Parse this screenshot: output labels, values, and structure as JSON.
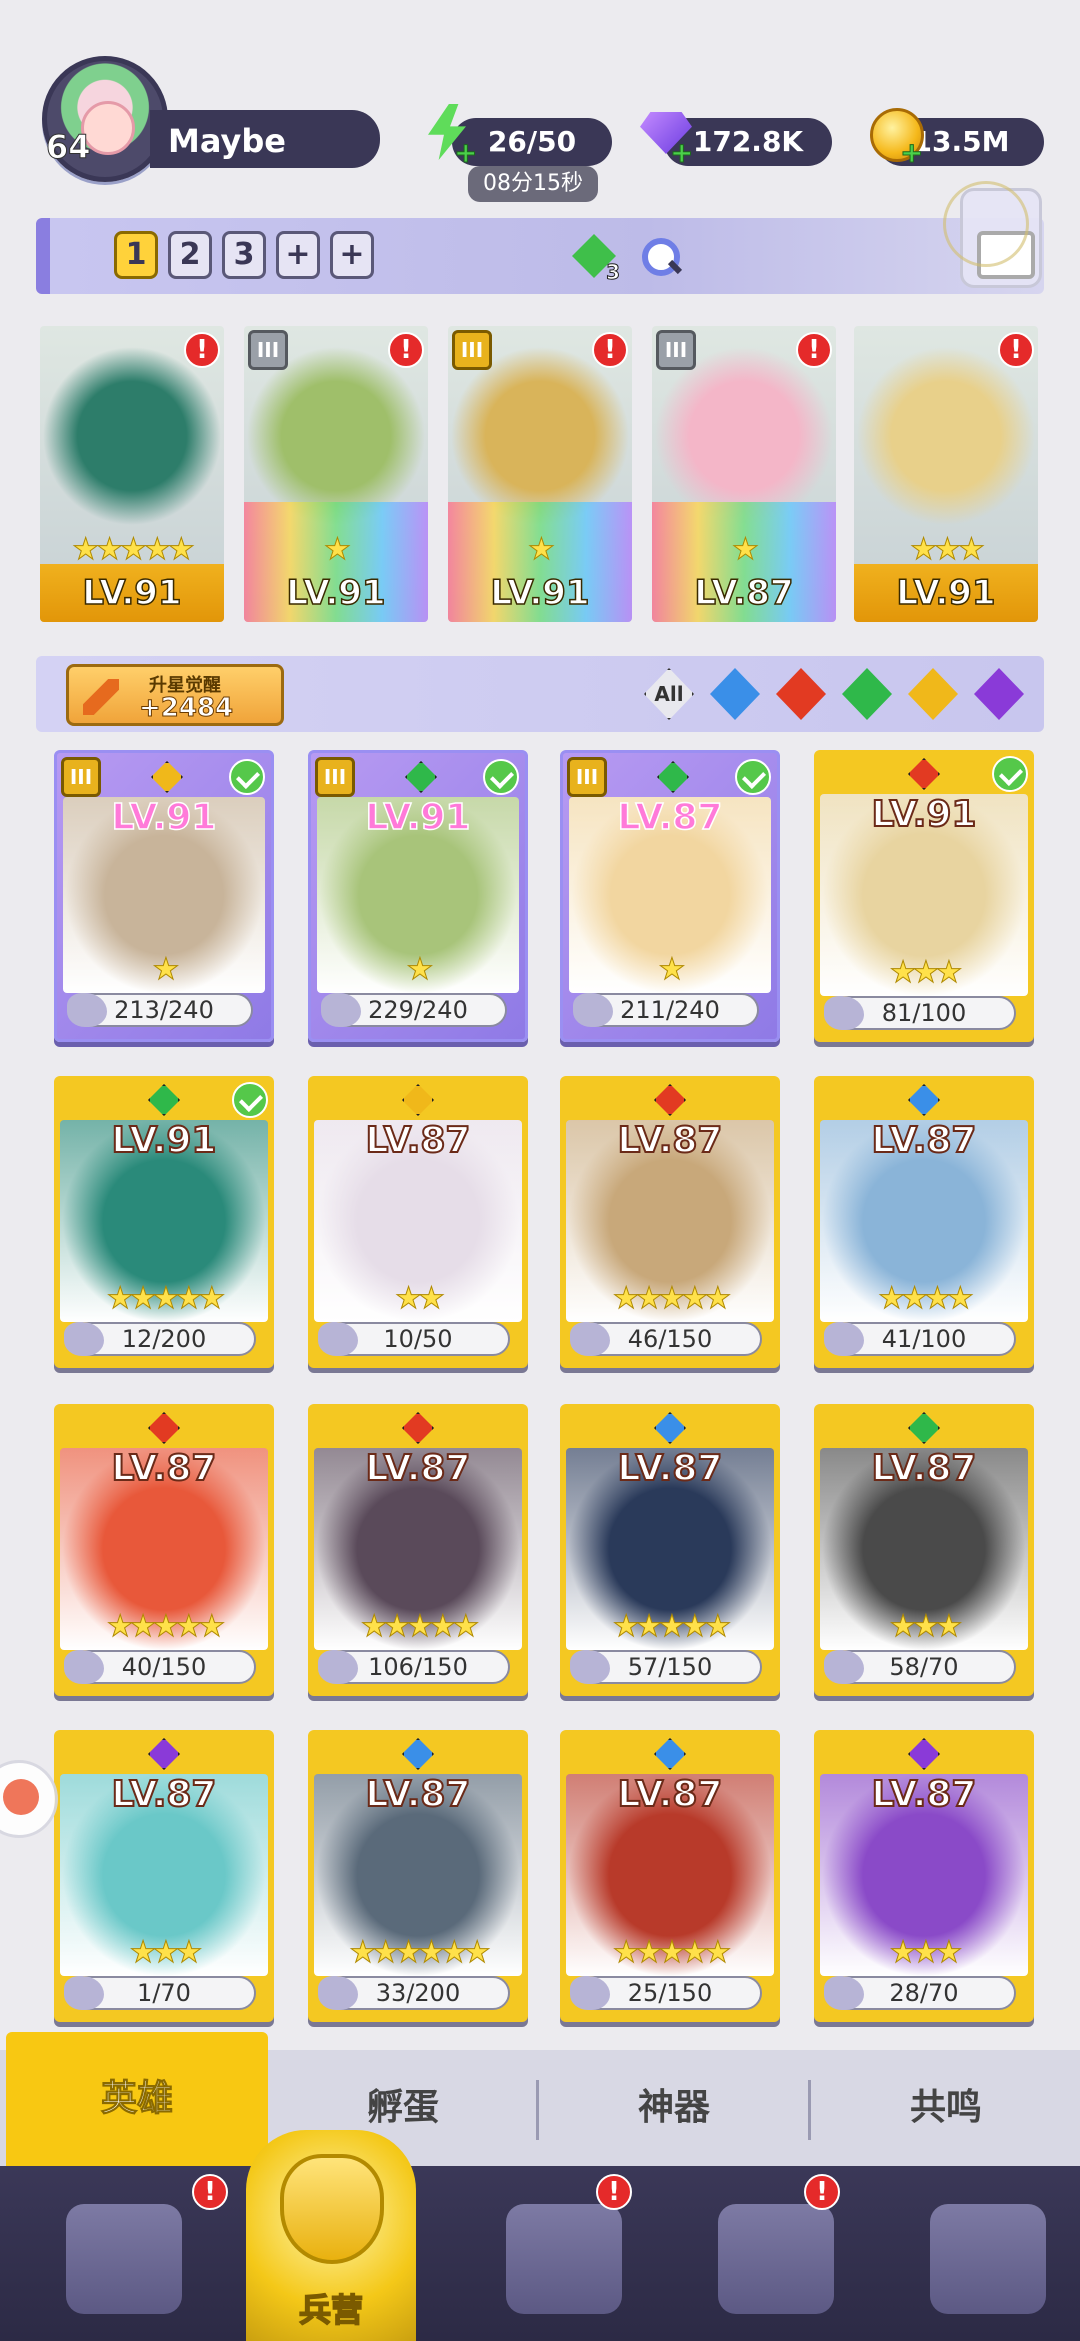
{
  "player": {
    "level": "64",
    "name": "Maybe"
  },
  "resources": {
    "energy": "26/50",
    "energy_timer": "08分15秒",
    "gems": "172.8K",
    "gold": "13.5M"
  },
  "team": {
    "tabs": [
      "1",
      "2",
      "3",
      "+",
      "+"
    ],
    "element_count": "3",
    "heroes": [
      {
        "level": "LV.91",
        "stars": "★★★★★",
        "element": "green",
        "rank": "",
        "art": "#2d7d6a"
      },
      {
        "level": "LV.91",
        "stars": "★",
        "element": "green",
        "rank": "III",
        "art": "#9fbf6a"
      },
      {
        "level": "LV.91",
        "stars": "★",
        "element": "gold",
        "rank": "III",
        "art": "#d9b45a"
      },
      {
        "level": "LV.87",
        "stars": "★",
        "element": "green",
        "rank": "III",
        "art": "#f4b6c8"
      },
      {
        "level": "LV.91",
        "stars": "★★★",
        "element": "red",
        "rank": "",
        "art": "#e8d08a"
      }
    ]
  },
  "awaken": {
    "title": "升星觉醒",
    "value": "+2484"
  },
  "filters": {
    "all_label": "All",
    "elements": [
      "water",
      "fire",
      "nature",
      "light",
      "dark"
    ]
  },
  "colors": {
    "water": "#3a8fe8",
    "fire": "#e23a22",
    "nature": "#2fb84a",
    "light": "#f0b81a",
    "dark": "#8a3ad8",
    "accent_yellow": "#f8c812",
    "nav_bg": "#3b3858"
  },
  "heroes": [
    {
      "level": "LV.91",
      "shards": "213/240",
      "stars": "★",
      "element": "light",
      "rank": "III",
      "check": true,
      "purple": true,
      "art": "#c8b49a"
    },
    {
      "level": "LV.91",
      "shards": "229/240",
      "stars": "★",
      "element": "nature",
      "rank": "III",
      "check": true,
      "purple": true,
      "art": "#a8c47a"
    },
    {
      "level": "LV.87",
      "shards": "211/240",
      "stars": "★",
      "element": "nature",
      "rank": "III",
      "check": true,
      "purple": true,
      "art": "#f2d6a0"
    },
    {
      "level": "LV.91",
      "shards": "81/100",
      "stars": "★★★",
      "element": "fire",
      "rank": "",
      "check": true,
      "purple": false,
      "art": "#e8d4a0"
    },
    {
      "level": "LV.91",
      "shards": "12/200",
      "stars": "★★★★★",
      "element": "nature",
      "rank": "",
      "check": true,
      "purple": false,
      "art": "#2a8a7a"
    },
    {
      "level": "LV.87",
      "shards": "10/50",
      "stars": "★★",
      "element": "light",
      "rank": "",
      "check": false,
      "purple": false,
      "art": "#e6dde8"
    },
    {
      "level": "LV.87",
      "shards": "46/150",
      "stars": "★★★★★",
      "element": "fire",
      "rank": "",
      "check": false,
      "purple": false,
      "art": "#c8a87a"
    },
    {
      "level": "LV.87",
      "shards": "41/100",
      "stars": "★★★★",
      "element": "water",
      "rank": "",
      "check": false,
      "purple": false,
      "art": "#8ab4d8"
    },
    {
      "level": "LV.87",
      "shards": "40/150",
      "stars": "★★★★★",
      "element": "fire",
      "rank": "",
      "check": false,
      "purple": false,
      "art": "#e8583a"
    },
    {
      "level": "LV.87",
      "shards": "106/150",
      "stars": "★★★★★",
      "element": "fire",
      "rank": "",
      "check": false,
      "purple": false,
      "art": "#5a4a5a"
    },
    {
      "level": "LV.87",
      "shards": "57/150",
      "stars": "★★★★★",
      "element": "water",
      "rank": "",
      "check": false,
      "purple": false,
      "art": "#2a3a5a"
    },
    {
      "level": "LV.87",
      "shards": "58/70",
      "stars": "★★★",
      "element": "nature",
      "rank": "",
      "check": false,
      "purple": false,
      "art": "#4a4a4a"
    },
    {
      "level": "LV.87",
      "shards": "1/70",
      "stars": "★★★",
      "element": "dark",
      "rank": "",
      "check": false,
      "purple": false,
      "art": "#6ac8c8"
    },
    {
      "level": "LV.87",
      "shards": "33/200",
      "stars": "★★★★★★",
      "element": "water",
      "rank": "",
      "check": false,
      "purple": false,
      "art": "#5a6a7a"
    },
    {
      "level": "LV.87",
      "shards": "25/150",
      "stars": "★★★★★",
      "element": "water",
      "rank": "",
      "check": false,
      "purple": false,
      "art": "#b83a2a"
    },
    {
      "level": "LV.87",
      "shards": "28/70",
      "stars": "★★★",
      "element": "dark",
      "rank": "",
      "check": false,
      "purple": false,
      "art": "#8a4ac8"
    }
  ],
  "subtabs": [
    "英雄",
    "孵蛋",
    "神器",
    "共鸣"
  ],
  "nav": {
    "home_label": "兵营",
    "alerts": [
      "!",
      "!",
      "!"
    ]
  }
}
